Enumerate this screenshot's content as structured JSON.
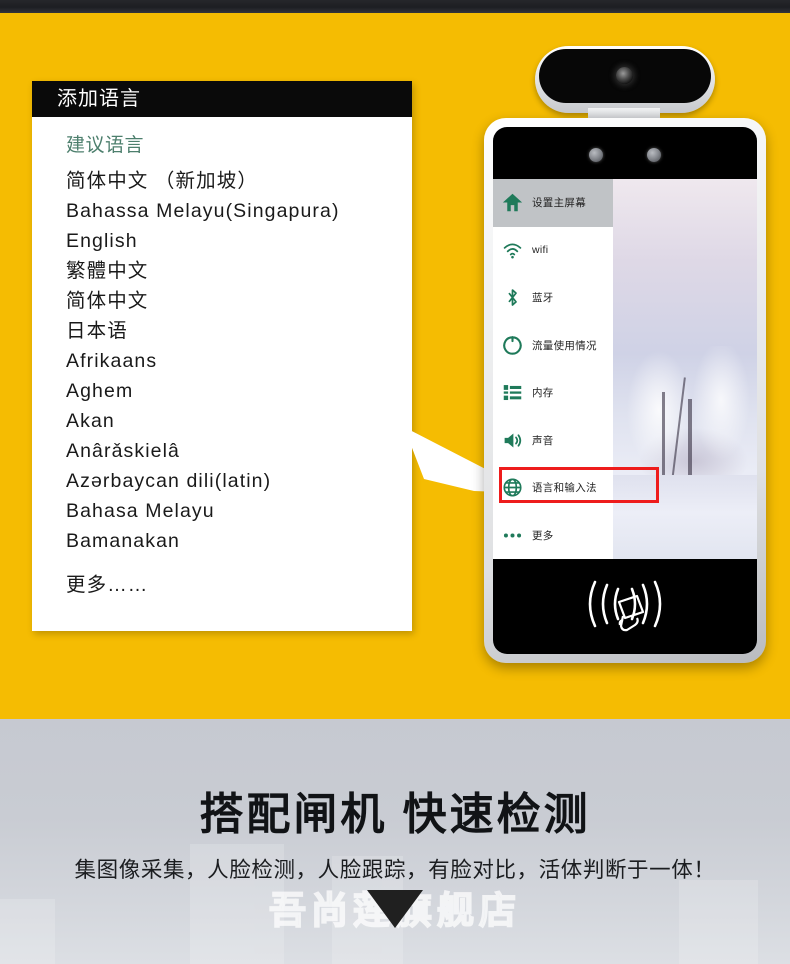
{
  "panel": {
    "title": "添加语言",
    "suggested_header": "建议语言",
    "languages": [
      "简体中文 （新加坡）",
      "Bahassa Melayu(Singapura)",
      "English",
      "繁體中文",
      "简体中文",
      "日本语",
      "Afrikaans",
      "Aghem",
      "Akan",
      "Anârǎskielâ",
      "Azərbaycan dili(latin)",
      "Bahasa Melayu",
      "Bamanakan"
    ],
    "more_label": "更多……"
  },
  "device": {
    "menu": [
      {
        "label": "设置主屏幕",
        "icon": "home-icon",
        "active": true
      },
      {
        "label": "wifi",
        "icon": "wifi-icon",
        "active": false
      },
      {
        "label": "蓝牙",
        "icon": "bluetooth-icon",
        "active": false
      },
      {
        "label": "流量使用情况",
        "icon": "data-usage-icon",
        "active": false
      },
      {
        "label": "内存",
        "icon": "storage-icon",
        "active": false
      },
      {
        "label": "声音",
        "icon": "sound-icon",
        "active": false
      },
      {
        "label": "语言和输入法",
        "icon": "globe-icon",
        "active": false
      },
      {
        "label": "更多",
        "icon": "more-dots-icon",
        "active": false
      }
    ],
    "highlighted_item": "语言和输入法",
    "nfc_icon": "rfid-card-tap-icon"
  },
  "bottom": {
    "headline": "搭配闸机 快速检测",
    "subline": "集图像采集，人脸检测，人脸跟踪，有脸对比，活体判断于一体！",
    "watermark": "吾尚莲旗舰店"
  },
  "colors": {
    "hero_yellow": "#f5bc02",
    "panel_title_bg": "#0a0a0a",
    "suggest_text": "#4d7f6d",
    "menu_icon_green": "#1f7a5a",
    "highlight_red": "#ee1c1c",
    "bottom_gray": "#c6c9d1"
  }
}
